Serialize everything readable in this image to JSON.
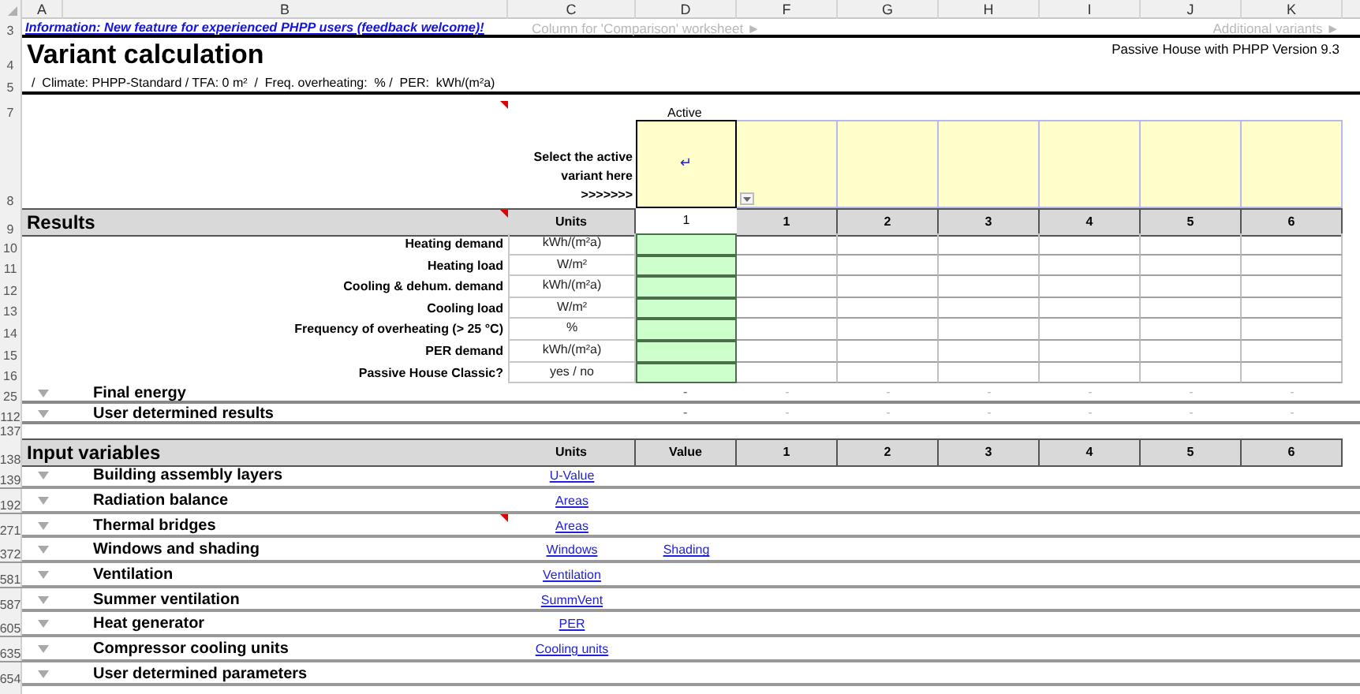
{
  "column_headers": [
    "A",
    "B",
    "C",
    "D",
    "F",
    "G",
    "H",
    "I",
    "J",
    "K"
  ],
  "info_row": {
    "row": "3",
    "link": "Information: New feature for experienced PHPP users (feedback welcome)!",
    "comparison_note": "Column for 'Comparison' worksheet ►",
    "additional_note": "Additional variants ►"
  },
  "title_row": {
    "row": "4",
    "title": "Variant calculation",
    "version": "Passive House with PHPP Version 9.3"
  },
  "subtitle_row": {
    "row": "5",
    "text": "/  Climate: PHPP-Standard / TFA: 0 m²  /  Freq. overheating:  % /  PER:  kWh/(m²a)"
  },
  "selector": {
    "label_row": "7",
    "row": "8",
    "active_label": "Active",
    "prompt": "Select the active\nvariant here\n>>>>>>>",
    "value": "↵",
    "comment": true
  },
  "results": {
    "row": "9",
    "title": "Results",
    "comment": true,
    "units_header": "Units",
    "active_header": "1",
    "variant_headers": [
      "1",
      "2",
      "3",
      "4",
      "5",
      "6"
    ],
    "rows": [
      {
        "row": "10",
        "label": "Heating demand",
        "units": "kWh/(m²a)"
      },
      {
        "row": "11",
        "label": "Heating load",
        "units": "W/m²"
      },
      {
        "row": "12",
        "label": "Cooling & dehum. demand",
        "units": "kWh/(m²a)"
      },
      {
        "row": "13",
        "label": "Cooling load",
        "units": "W/m²"
      },
      {
        "row": "14",
        "label": "Frequency of overheating (> 25 °C)",
        "units": "%"
      },
      {
        "row": "15",
        "label": "PER demand",
        "units": "kWh/(m²a)"
      },
      {
        "row": "16",
        "label": "Passive House Classic?",
        "units": "yes / no"
      }
    ]
  },
  "summary_rows": [
    {
      "row": "25",
      "label": "Final energy",
      "active": "-",
      "variants": [
        "-",
        "-",
        "-",
        "-",
        "-",
        "-"
      ]
    },
    {
      "row": "112",
      "label": "User determined results",
      "active": "-",
      "variants": [
        "-",
        "-",
        "-",
        "-",
        "-",
        "-"
      ]
    }
  ],
  "spacer_row": "137",
  "inputs": {
    "row": "138",
    "title": "Input variables",
    "units_header": "Units",
    "value_header": "Value",
    "variant_headers": [
      "1",
      "2",
      "3",
      "4",
      "5",
      "6"
    ],
    "rows": [
      {
        "row": "139",
        "label": "Building assembly layers",
        "units_link": "U-Value",
        "comment": false
      },
      {
        "row": "192",
        "label": "Radiation balance",
        "units_link": "Areas",
        "comment": false
      },
      {
        "row": "271",
        "label": "Thermal bridges",
        "units_link": "Areas",
        "comment": true
      },
      {
        "row": "372",
        "label": "Windows and shading",
        "units_link": "Windows",
        "value_link": "Shading",
        "comment": false
      },
      {
        "row": "581",
        "label": "Ventilation",
        "units_link": "Ventilation",
        "comment": false
      },
      {
        "row": "587",
        "label": "Summer ventilation",
        "units_link": "SummVent",
        "comment": false
      },
      {
        "row": "605",
        "label": "Heat generator",
        "units_link": "PER",
        "comment": false
      },
      {
        "row": "635",
        "label": "Compressor cooling units",
        "units_link": "Cooling units",
        "comment": false
      },
      {
        "row": "654",
        "label": "User determined parameters",
        "comment": false
      }
    ]
  }
}
